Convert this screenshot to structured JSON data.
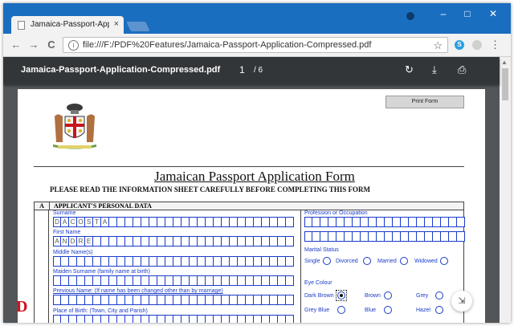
{
  "browser": {
    "tab_title": "Jamaica-Passport-Applica",
    "tab_close": "×",
    "window_controls": {
      "minimize": "–",
      "maximize": "□",
      "close": "✕"
    },
    "back_icon": "←",
    "forward_icon": "→",
    "reload_icon": "C",
    "url": "file:///F:/PDF%20Features/Jamaica-Passport-Application-Compressed.pdf",
    "info_icon": "i",
    "star_icon": "☆",
    "skype_icon": "S",
    "menu_icon": "⋮"
  },
  "pdf_viewer": {
    "doc_title": "Jamaica-Passport-Application-Compressed.pdf",
    "page_current": "1",
    "page_total": "/ 6",
    "rotate_icon": "↻",
    "download_icon": "⤓",
    "print_icon": "⎙"
  },
  "form": {
    "print_button": "Print Form",
    "title": "Jamaican Passport Application Form",
    "subtitle": "PLEASE READ THE INFORMATION SHEET CAREFULLY BEFORE COMPLETING THIS FORM",
    "section_letter": "A",
    "section_title": "APPLICANT'S PERSONAL DATA",
    "fields": {
      "surname_label": "Surname",
      "surname_chars": [
        "D",
        "A",
        "C",
        "O",
        "S",
        "T",
        "A"
      ],
      "first_name_label": "First Name",
      "first_name_chars": [
        "A",
        "N",
        "D",
        "R",
        "E"
      ],
      "middle_name_label": "Middle Name(s)",
      "maiden_label": "Maiden Surname (family name at birth)",
      "previous_label": "Previous Name:  (If name has been changed other than by marriage)",
      "birth_place_label": "Place of Birth: (Town, City and Parish)",
      "profession_label": "Profession or Occupation",
      "marital_label": "Marital Status",
      "marital_options": [
        "Single",
        "Divorced",
        "Married",
        "Widowed"
      ],
      "eye_label": "Eye Colour",
      "eye_options": [
        "Dark Brown",
        "Brown",
        "Grey",
        "Grey Blue",
        "Blue",
        "Hazel"
      ],
      "eye_selected": "Dark Brown"
    },
    "fab_icon": "⇲"
  },
  "colors": {
    "chrome_blue": "#1a6ec0",
    "viewer_dark": "#323639",
    "form_blue": "#1a3cc7",
    "red_mark": "#c8141e"
  }
}
